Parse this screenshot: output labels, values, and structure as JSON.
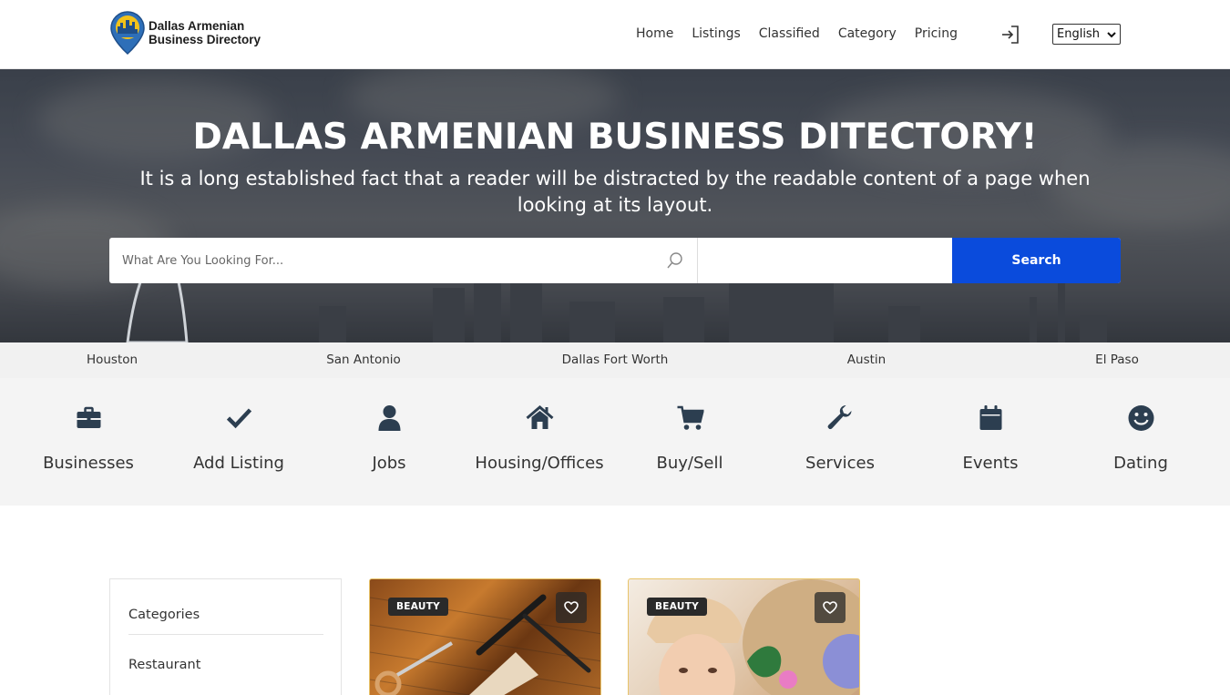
{
  "header": {
    "logo_line1": "Dallas Armenian",
    "logo_line2": "Business Directory",
    "nav": [
      "Home",
      "Listings",
      "Classified",
      "Category",
      "Pricing"
    ],
    "language": "English"
  },
  "hero": {
    "title": "DALLAS ARMENIAN BUSINESS DITECTORY!",
    "subtitle": "It is a long established fact that a reader will be distracted by the readable content of a page when looking at its layout.",
    "search_placeholder": "What Are You Looking For...",
    "search_button": "Search"
  },
  "cities": [
    "Houston",
    "San Antonio",
    "Dallas Fort Worth",
    "Austin",
    "El Paso"
  ],
  "categories": [
    {
      "label": "Businesses",
      "icon": "briefcase-icon"
    },
    {
      "label": "Add Listing",
      "icon": "check-icon"
    },
    {
      "label": "Jobs",
      "icon": "user-icon"
    },
    {
      "label": "Housing/Offices",
      "icon": "home-icon"
    },
    {
      "label": "Buy/Sell",
      "icon": "cart-icon"
    },
    {
      "label": "Services",
      "icon": "wrench-icon"
    },
    {
      "label": "Events",
      "icon": "calendar-icon"
    },
    {
      "label": "Dating",
      "icon": "smile-icon"
    }
  ],
  "sidebar": {
    "heading": "Categories",
    "items": [
      "Restaurant"
    ]
  },
  "cards": [
    {
      "badge": "BEAUTY"
    },
    {
      "badge": "BEAUTY"
    }
  ],
  "colors": {
    "accent": "#0a4bdc",
    "icon": "#2c3e50"
  }
}
